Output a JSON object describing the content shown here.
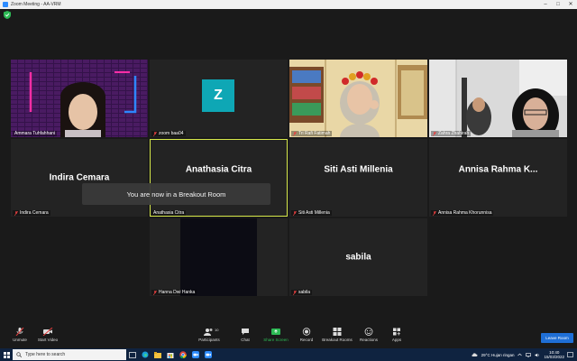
{
  "window": {
    "title": "Zoom Meeting - AA-VRM",
    "minimize": "–",
    "maximize": "□",
    "close": "✕"
  },
  "tiles": [
    {
      "name": "Ammara Tuhfahhani",
      "type": "video",
      "muted": false
    },
    {
      "name": "zoom baa04",
      "type": "avatar",
      "initial": "Z",
      "muted": true
    },
    {
      "name": "Tri Rafi Fatimah",
      "type": "video",
      "muted": true
    },
    {
      "name": "Zahra Zhahirah",
      "type": "video",
      "muted": true
    },
    {
      "name": "Indira Cemara",
      "type": "name",
      "big": "Indira Cemara",
      "muted": true
    },
    {
      "name": "Anathasia Citra",
      "type": "name",
      "big": "Anathasia Citra",
      "muted": false,
      "active": true
    },
    {
      "name": "Siti Asti Millenia",
      "type": "name",
      "big": "Siti Asti Millenia",
      "muted": true
    },
    {
      "name": "Annisa Rahma Khorunnisa",
      "type": "name",
      "big": "Annisa  Rahma  K...",
      "muted": true
    },
    {
      "name": "Hanna Dwi Hanka",
      "type": "video",
      "muted": true
    },
    {
      "name": "sabila",
      "type": "name",
      "big": "sabila",
      "muted": true
    }
  ],
  "banner": "You are now in a Breakout Room",
  "toolbar": {
    "unmute": "Unmute",
    "start_video": "Start Video",
    "participants": "Participants",
    "participants_count": "10",
    "chat": "Chat",
    "share_screen": "Share Screen",
    "record": "Record",
    "breakout_rooms": "Breakout Rooms",
    "reactions": "Reactions",
    "apps": "Apps",
    "leave": "Leave Room"
  },
  "taskbar": {
    "search_placeholder": "Type here to search",
    "weather": "29°C  Hujan ringan",
    "time": "10:40",
    "date": "15/03/2022"
  },
  "colors": {
    "accent": "#d6e84a",
    "zoom_blue": "#2d8cff",
    "leave": "#1f6fd6",
    "avatar": "#0ea7b5"
  }
}
